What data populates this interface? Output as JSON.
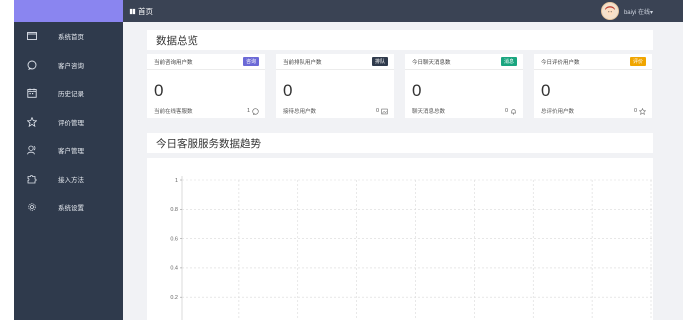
{
  "topbar": {
    "breadcrumb": "首页",
    "user_name": "baiyi 在线▾"
  },
  "sidebar": {
    "items": [
      {
        "label": "系统首页",
        "icon": "monitor-icon"
      },
      {
        "label": "客户咨询",
        "icon": "chat-bubble-icon"
      },
      {
        "label": "历史记录",
        "icon": "calendar-icon"
      },
      {
        "label": "评价管理",
        "icon": "star-icon"
      },
      {
        "label": "客户管理",
        "icon": "users-icon"
      },
      {
        "label": "接入方法",
        "icon": "puzzle-icon"
      },
      {
        "label": "系统设置",
        "icon": "gear-icon"
      }
    ]
  },
  "overview": {
    "title": "数据总览",
    "cards": [
      {
        "label": "当前咨询用户数",
        "badge": "咨询",
        "badge_color": "#6b69d6",
        "value": "0",
        "footer_label": "当前在线客服数",
        "footer_value": "1",
        "footer_icon": "chat-bubble-icon"
      },
      {
        "label": "当前排队用户数",
        "badge": "排队",
        "badge_color": "#2f3a4c",
        "value": "0",
        "footer_label": "接待总用户数",
        "footer_value": "0",
        "footer_icon": "image-icon"
      },
      {
        "label": "今日聊天消息数",
        "badge": "消息",
        "badge_color": "#1aa57f",
        "value": "0",
        "footer_label": "聊天消息总数",
        "footer_value": "0",
        "footer_icon": "bell-icon"
      },
      {
        "label": "今日评价用户数",
        "badge": "评价",
        "badge_color": "#f0a500",
        "value": "0",
        "footer_label": "总评价用户数",
        "footer_value": "0",
        "footer_icon": "star-icon"
      }
    ]
  },
  "trend": {
    "title": "今日客服服务数据趋势"
  },
  "chart_data": {
    "type": "line",
    "title": "",
    "y_ticks": [
      "1",
      "0.8",
      "0.6",
      "0.4",
      "0.2"
    ],
    "ylim": [
      0,
      1
    ],
    "grid": true,
    "series": []
  }
}
